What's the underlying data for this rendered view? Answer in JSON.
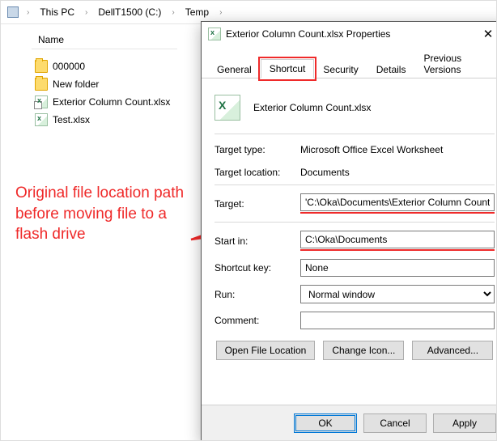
{
  "breadcrumb": {
    "items": [
      "This PC",
      "DellT1500 (C:)",
      "Temp"
    ]
  },
  "explorer": {
    "column_header": "Name",
    "files": [
      {
        "name": "000000",
        "kind": "folder"
      },
      {
        "name": "New folder",
        "kind": "folder"
      },
      {
        "name": "Exterior Column Count.xlsx",
        "kind": "xlsx-shortcut"
      },
      {
        "name": "Test.xlsx",
        "kind": "xlsx"
      }
    ]
  },
  "annotation": {
    "text": "Original file location path before moving file to a flash drive"
  },
  "dialog": {
    "title": "Exterior Column Count.xlsx Properties",
    "tabs": [
      "General",
      "Shortcut",
      "Security",
      "Details",
      "Previous Versions"
    ],
    "active_tab": "Shortcut",
    "filename": "Exterior Column Count.xlsx",
    "fields": {
      "target_type_label": "Target type:",
      "target_type_value": "Microsoft Office Excel Worksheet",
      "target_location_label": "Target location:",
      "target_location_value": "Documents",
      "target_label": "Target:",
      "target_value": "'C:\\Oka\\Documents\\Exterior Column Count.xlsx\"",
      "start_in_label": "Start in:",
      "start_in_value": "C:\\Oka\\Documents",
      "shortcut_key_label": "Shortcut key:",
      "shortcut_key_value": "None",
      "run_label": "Run:",
      "run_value": "Normal window",
      "comment_label": "Comment:",
      "comment_value": ""
    },
    "buttons": {
      "open_file_location": "Open File Location",
      "change_icon": "Change Icon...",
      "advanced": "Advanced..."
    },
    "footer": {
      "ok": "OK",
      "cancel": "Cancel",
      "apply": "Apply"
    }
  }
}
